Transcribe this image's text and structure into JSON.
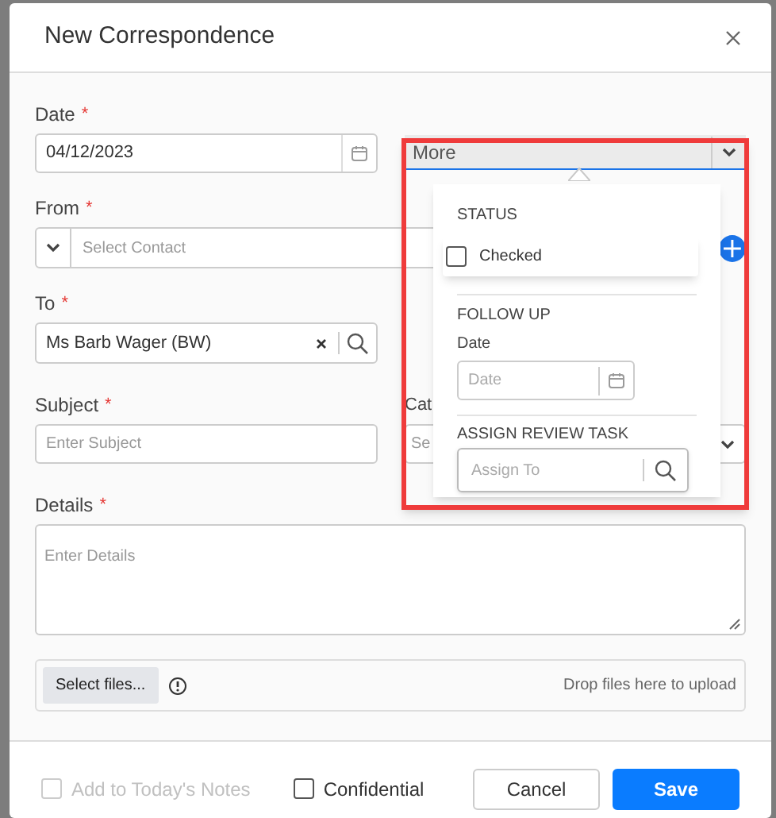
{
  "dialog": {
    "title": "New Correspondence"
  },
  "date": {
    "label": "Date",
    "required_mark": "*",
    "value": "04/12/2023"
  },
  "more": {
    "value": "More",
    "expanded": true,
    "popup": {
      "status_heading": "STATUS",
      "status_checkbox": {
        "label": "Checked",
        "checked": false
      },
      "follow_up_heading": "FOLLOW UP",
      "follow_up_date_label": "Date",
      "follow_up_date_placeholder": "Date",
      "assign_heading": "ASSIGN REVIEW TASK",
      "assign_placeholder": "Assign To"
    }
  },
  "from": {
    "label": "From",
    "required_mark": "*",
    "placeholder": "Select Contact"
  },
  "to": {
    "label": "To",
    "required_mark": "*",
    "value": "Ms Barb Wager (BW)"
  },
  "subject": {
    "label": "Subject",
    "required_mark": "*",
    "placeholder": "Enter Subject"
  },
  "category": {
    "label": "Cat",
    "placeholder": "Se"
  },
  "details": {
    "label": "Details",
    "required_mark": "*",
    "placeholder": "Enter Details"
  },
  "upload": {
    "button": "Select files...",
    "hint": "Drop files here to upload"
  },
  "footer": {
    "checkboxes": [
      {
        "label": "Add to Today's Notes",
        "checked": false,
        "disabled": true
      },
      {
        "label": "Confidential",
        "checked": false,
        "disabled": false
      }
    ],
    "buttons": [
      {
        "label": "Cancel",
        "kind": "secondary"
      },
      {
        "label": "Save",
        "kind": "primary"
      }
    ]
  }
}
